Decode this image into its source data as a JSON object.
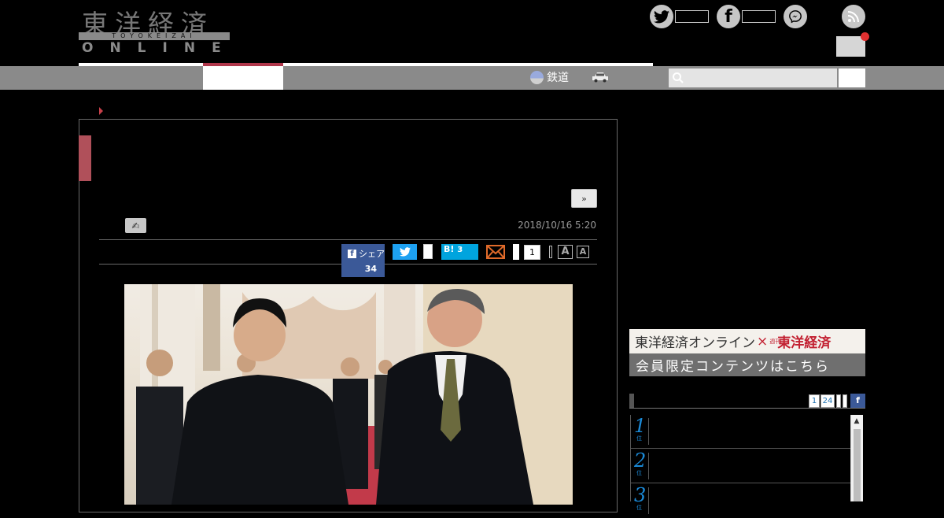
{
  "brand": {
    "logo_kanji": "東洋経済",
    "logo_band": "TOYOKEIZAI",
    "logo_online": "ONLINE"
  },
  "header": {
    "social_icons": [
      "twitter-icon",
      "facebook-icon",
      "messenger-icon",
      "rss-icon"
    ],
    "notification_color": "#e03030"
  },
  "nav": {
    "rail_label": "鉄道",
    "search": {
      "placeholder": ""
    },
    "accent_color": "#b0374b"
  },
  "article": {
    "date": "2018/10/16 5:20",
    "next_label": "»",
    "share": {
      "facebook_label": "シェア",
      "facebook_count": "34",
      "hatena_label": "B!",
      "hatena_count": "3",
      "pocket_count": "1",
      "font_large": "A",
      "font_small": "A"
    }
  },
  "sidebar": {
    "banner": {
      "line1_left": "東洋経済オンライン",
      "line1_x": "×",
      "line1_weekly": "週刊",
      "line1_brand": "東洋経済",
      "line2": "会員限定コンテンツはこちら"
    },
    "ranking": {
      "tabs": [
        "1",
        "24"
      ],
      "facebook_tab": "f",
      "items": [
        {
          "rank": "1",
          "unit": "位"
        },
        {
          "rank": "2",
          "unit": "位"
        },
        {
          "rank": "3",
          "unit": "位"
        }
      ]
    }
  }
}
